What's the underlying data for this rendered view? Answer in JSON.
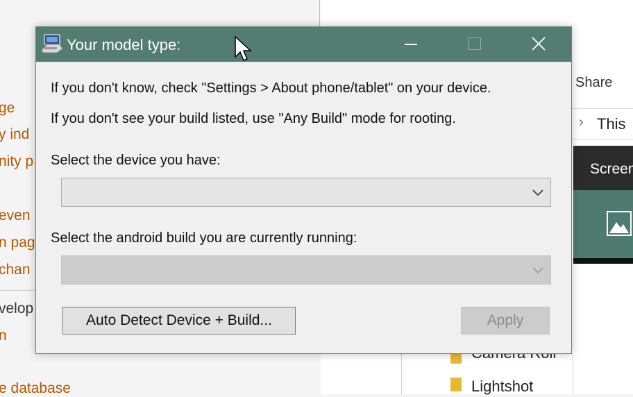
{
  "background_page": {
    "links": [
      "ge",
      "y ind",
      "nity p",
      "even",
      "n pag",
      "chan",
      "n",
      "e database"
    ],
    "text": [
      "velop"
    ]
  },
  "explorer": {
    "share_label": "Share",
    "address_text": "This",
    "banner_text": "Screen",
    "folders": [
      "Camera Roll",
      "Lightshot"
    ]
  },
  "dialog": {
    "title": "Your model type:",
    "info_line_1": "If you don't know, check \"Settings > About phone/tablet\" on your device.",
    "info_line_2": "If you don't see your build listed, use \"Any Build\" mode for rooting.",
    "device_label": "Select the device you have:",
    "device_value": "",
    "build_label": "Select the android build you are currently running:",
    "build_value": "",
    "auto_detect_button": "Auto Detect Device + Build...",
    "apply_button": "Apply"
  },
  "colors": {
    "titlebar": "#547d71",
    "link": "#b35a00",
    "dialog_bg": "#f0f0f0"
  },
  "icons": {
    "app": "computer-network-icon",
    "minimize": "minimize-icon",
    "maximize": "maximize-icon",
    "close": "close-icon",
    "dropdown": "chevron-down-icon",
    "cursor": "mouse-pointer-icon"
  }
}
